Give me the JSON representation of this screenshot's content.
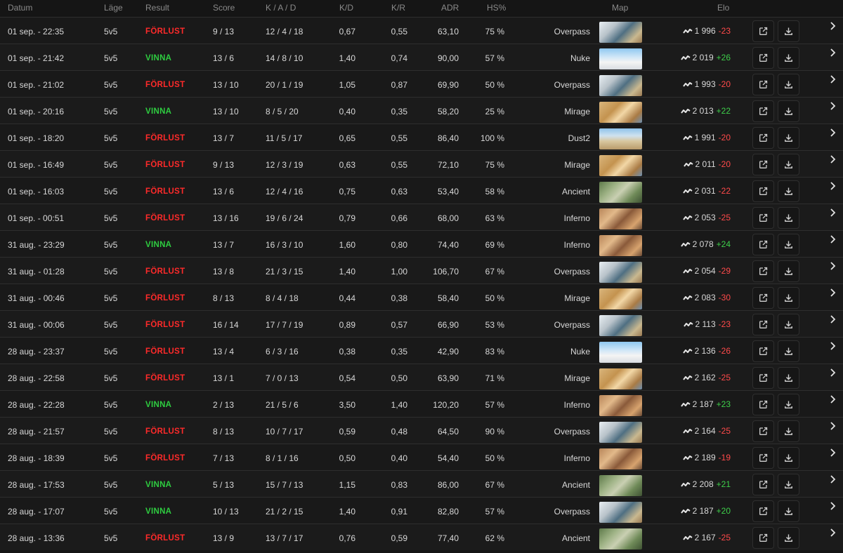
{
  "columns": {
    "date": "Datum",
    "mode": "Läge",
    "result": "Result",
    "score": "Score",
    "kad": "K / A / D",
    "kd": "K/D",
    "kr": "K/R",
    "adr": "ADR",
    "hs": "HS%",
    "map": "Map",
    "elo": "Elo"
  },
  "colors": {
    "win": "#2ecc40",
    "loss": "#ff2a2a",
    "elo_up": "#3ecf4a",
    "elo_down": "#ff4a4a",
    "brand_accent": "#ff5500"
  },
  "icons": {
    "elo_trend": "trend-icon",
    "open": "external-link-icon",
    "download": "download-icon",
    "expand": "chevron-right-icon"
  },
  "rows": [
    {
      "date": "01 sep. - 22:35",
      "mode": "5v5",
      "result": "FÖRLUST",
      "win": false,
      "score": "9 / 13",
      "kad": "12 / 4 / 18",
      "kd": "0,67",
      "kr": "0,55",
      "adr": "63,10",
      "hs": "75 %",
      "map": "Overpass",
      "elo": "1 996",
      "delta": "-23"
    },
    {
      "date": "01 sep. - 21:42",
      "mode": "5v5",
      "result": "VINNA",
      "win": true,
      "score": "13 / 6",
      "kad": "14 / 8 / 10",
      "kd": "1,40",
      "kr": "0,74",
      "adr": "90,00",
      "hs": "57 %",
      "map": "Nuke",
      "elo": "2 019",
      "delta": "+26"
    },
    {
      "date": "01 sep. - 21:02",
      "mode": "5v5",
      "result": "FÖRLUST",
      "win": false,
      "score": "13 / 10",
      "kad": "20 / 1 / 19",
      "kd": "1,05",
      "kr": "0,87",
      "adr": "69,90",
      "hs": "50 %",
      "map": "Overpass",
      "elo": "1 993",
      "delta": "-20"
    },
    {
      "date": "01 sep. - 20:16",
      "mode": "5v5",
      "result": "VINNA",
      "win": true,
      "score": "13 / 10",
      "kad": "8 / 5 / 20",
      "kd": "0,40",
      "kr": "0,35",
      "adr": "58,20",
      "hs": "25 %",
      "map": "Mirage",
      "elo": "2 013",
      "delta": "+22"
    },
    {
      "date": "01 sep. - 18:20",
      "mode": "5v5",
      "result": "FÖRLUST",
      "win": false,
      "score": "13 / 7",
      "kad": "11 / 5 / 17",
      "kd": "0,65",
      "kr": "0,55",
      "adr": "86,40",
      "hs": "100 %",
      "map": "Dust2",
      "elo": "1 991",
      "delta": "-20"
    },
    {
      "date": "01 sep. - 16:49",
      "mode": "5v5",
      "result": "FÖRLUST",
      "win": false,
      "score": "9 / 13",
      "kad": "12 / 3 / 19",
      "kd": "0,63",
      "kr": "0,55",
      "adr": "72,10",
      "hs": "75 %",
      "map": "Mirage",
      "elo": "2 011",
      "delta": "-20"
    },
    {
      "date": "01 sep. - 16:03",
      "mode": "5v5",
      "result": "FÖRLUST",
      "win": false,
      "score": "13 / 6",
      "kad": "12 / 4 / 16",
      "kd": "0,75",
      "kr": "0,63",
      "adr": "53,40",
      "hs": "58 %",
      "map": "Ancient",
      "elo": "2 031",
      "delta": "-22"
    },
    {
      "date": "01 sep. - 00:51",
      "mode": "5v5",
      "result": "FÖRLUST",
      "win": false,
      "score": "13 / 16",
      "kad": "19 / 6 / 24",
      "kd": "0,79",
      "kr": "0,66",
      "adr": "68,00",
      "hs": "63 %",
      "map": "Inferno",
      "elo": "2 053",
      "delta": "-25"
    },
    {
      "date": "31 aug. - 23:29",
      "mode": "5v5",
      "result": "VINNA",
      "win": true,
      "score": "13 / 7",
      "kad": "16 / 3 / 10",
      "kd": "1,60",
      "kr": "0,80",
      "adr": "74,40",
      "hs": "69 %",
      "map": "Inferno",
      "elo": "2 078",
      "delta": "+24"
    },
    {
      "date": "31 aug. - 01:28",
      "mode": "5v5",
      "result": "FÖRLUST",
      "win": false,
      "score": "13 / 8",
      "kad": "21 / 3 / 15",
      "kd": "1,40",
      "kr": "1,00",
      "adr": "106,70",
      "hs": "67 %",
      "map": "Overpass",
      "elo": "2 054",
      "delta": "-29"
    },
    {
      "date": "31 aug. - 00:46",
      "mode": "5v5",
      "result": "FÖRLUST",
      "win": false,
      "score": "8 / 13",
      "kad": "8 / 4 / 18",
      "kd": "0,44",
      "kr": "0,38",
      "adr": "58,40",
      "hs": "50 %",
      "map": "Mirage",
      "elo": "2 083",
      "delta": "-30"
    },
    {
      "date": "31 aug. - 00:06",
      "mode": "5v5",
      "result": "FÖRLUST",
      "win": false,
      "score": "16 / 14",
      "kad": "17 / 7 / 19",
      "kd": "0,89",
      "kr": "0,57",
      "adr": "66,90",
      "hs": "53 %",
      "map": "Overpass",
      "elo": "2 113",
      "delta": "-23"
    },
    {
      "date": "28 aug. - 23:37",
      "mode": "5v5",
      "result": "FÖRLUST",
      "win": false,
      "score": "13 / 4",
      "kad": "6 / 3 / 16",
      "kd": "0,38",
      "kr": "0,35",
      "adr": "42,90",
      "hs": "83 %",
      "map": "Nuke",
      "elo": "2 136",
      "delta": "-26"
    },
    {
      "date": "28 aug. - 22:58",
      "mode": "5v5",
      "result": "FÖRLUST",
      "win": false,
      "score": "13 / 1",
      "kad": "7 / 0 / 13",
      "kd": "0,54",
      "kr": "0,50",
      "adr": "63,90",
      "hs": "71 %",
      "map": "Mirage",
      "elo": "2 162",
      "delta": "-25"
    },
    {
      "date": "28 aug. - 22:28",
      "mode": "5v5",
      "result": "VINNA",
      "win": true,
      "score": "2 / 13",
      "kad": "21 / 5 / 6",
      "kd": "3,50",
      "kr": "1,40",
      "adr": "120,20",
      "hs": "57 %",
      "map": "Inferno",
      "elo": "2 187",
      "delta": "+23"
    },
    {
      "date": "28 aug. - 21:57",
      "mode": "5v5",
      "result": "FÖRLUST",
      "win": false,
      "score": "8 / 13",
      "kad": "10 / 7 / 17",
      "kd": "0,59",
      "kr": "0,48",
      "adr": "64,50",
      "hs": "90 %",
      "map": "Overpass",
      "elo": "2 164",
      "delta": "-25"
    },
    {
      "date": "28 aug. - 18:39",
      "mode": "5v5",
      "result": "FÖRLUST",
      "win": false,
      "score": "7 / 13",
      "kad": "8 / 1 / 16",
      "kd": "0,50",
      "kr": "0,40",
      "adr": "54,40",
      "hs": "50 %",
      "map": "Inferno",
      "elo": "2 189",
      "delta": "-19"
    },
    {
      "date": "28 aug. - 17:53",
      "mode": "5v5",
      "result": "VINNA",
      "win": true,
      "score": "5 / 13",
      "kad": "15 / 7 / 13",
      "kd": "1,15",
      "kr": "0,83",
      "adr": "86,00",
      "hs": "67 %",
      "map": "Ancient",
      "elo": "2 208",
      "delta": "+21"
    },
    {
      "date": "28 aug. - 17:07",
      "mode": "5v5",
      "result": "VINNA",
      "win": true,
      "score": "10 / 13",
      "kad": "21 / 2 / 15",
      "kd": "1,40",
      "kr": "0,91",
      "adr": "82,80",
      "hs": "57 %",
      "map": "Overpass",
      "elo": "2 187",
      "delta": "+20"
    },
    {
      "date": "28 aug. - 13:36",
      "mode": "5v5",
      "result": "FÖRLUST",
      "win": false,
      "score": "13 / 9",
      "kad": "13 / 7 / 17",
      "kd": "0,76",
      "kr": "0,59",
      "adr": "77,40",
      "hs": "62 %",
      "map": "Ancient",
      "elo": "2 167",
      "delta": "-25"
    }
  ]
}
